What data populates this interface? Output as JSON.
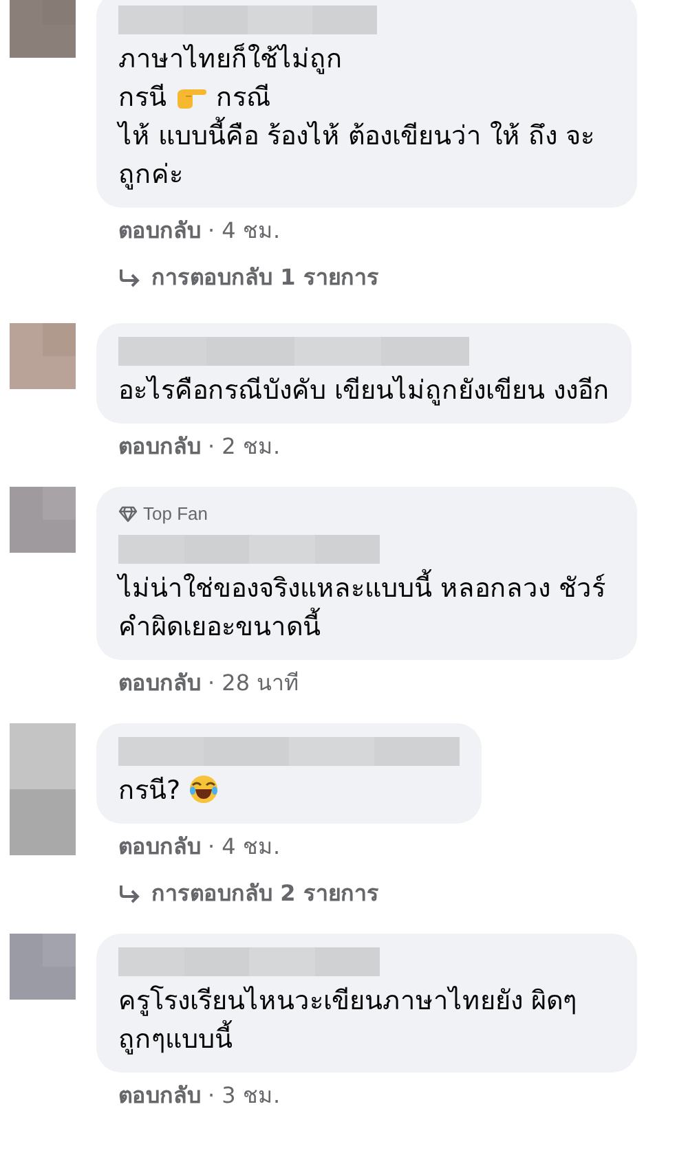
{
  "comments": [
    {
      "lines": [
        [
          {
            "kind": "text",
            "text": "ภาษาไทยก็ใช้ไม่ถูก"
          }
        ],
        [
          {
            "kind": "text",
            "text": "กรนี"
          },
          {
            "kind": "point-right"
          },
          {
            "kind": "text",
            "text": "กรณี"
          }
        ],
        [
          {
            "kind": "text",
            "text": "ไห้ แบบนี้คือ ร้องไห้ ต้องเขียนว่า ให้ ถึง จะถูกค่ะ"
          }
        ]
      ],
      "reply_label": "ตอบกลับ",
      "time": "· 4 ชม.",
      "replies": "การตอบกลับ 1 รายการ"
    },
    {
      "lines": [
        [
          {
            "kind": "text",
            "text": "อะไรคือกรณีบังคับ เขียนไม่ถูกยังเขียน งงอีก"
          }
        ]
      ],
      "reply_label": "ตอบกลับ",
      "time": "· 2 ชม."
    },
    {
      "badge": "Top Fan",
      "lines": [
        [
          {
            "kind": "text",
            "text": "ไม่น่าใช่ของจริงแหละแบบนี้ หลอกลวง ชัวร์ คำผิดเยอะขนาดนี้"
          }
        ]
      ],
      "reply_label": "ตอบกลับ",
      "time": "· 28 นาที"
    },
    {
      "lines": [
        [
          {
            "kind": "text",
            "text": "กรนี?"
          },
          {
            "kind": "laughing"
          }
        ]
      ],
      "reply_label": "ตอบกลับ",
      "time": "· 4 ชม.",
      "replies": "การตอบกลับ 2 รายการ"
    },
    {
      "lines": [
        [
          {
            "kind": "text",
            "text": "ครูโรงเรียนไหนวะเขียนภาษาไทยยัง ผิดๆถูกๆแบบนี้"
          }
        ]
      ],
      "reply_label": "ตอบกลับ",
      "time": "· 3 ชม."
    }
  ]
}
